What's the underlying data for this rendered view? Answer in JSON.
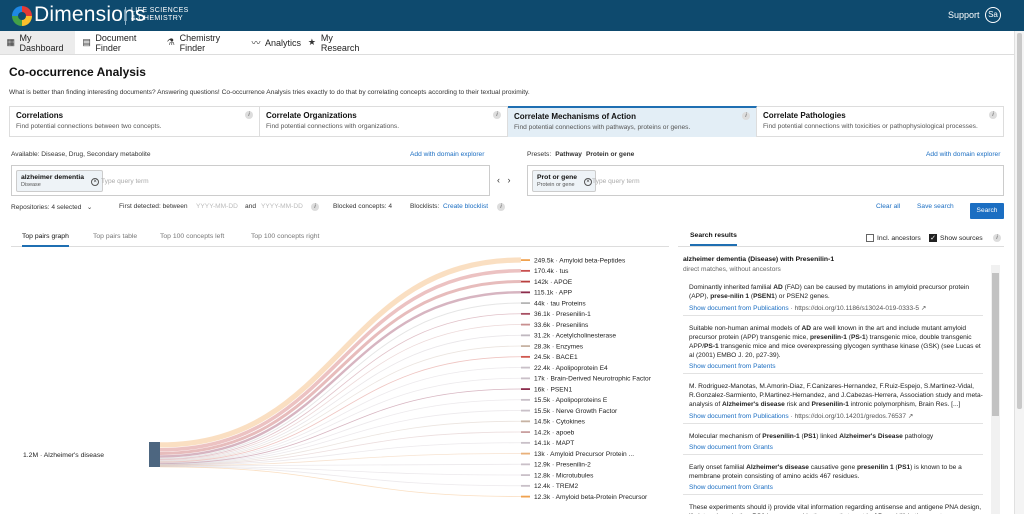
{
  "topbar": {
    "brand": "Dimensions",
    "brand_sub": "LIFE SCIENCES & CHEMISTRY",
    "support": "Support",
    "avatar": "Sa"
  },
  "nav": [
    {
      "label": "My Dashboard",
      "icon": "dashboard-icon",
      "glyph": "▦"
    },
    {
      "label": "Document Finder",
      "icon": "document-icon",
      "glyph": "▤"
    },
    {
      "label": "Chemistry Finder",
      "icon": "flask-icon",
      "glyph": "⚗"
    },
    {
      "label": "Analytics",
      "icon": "chart-line-icon",
      "glyph": "〰"
    },
    {
      "label": "My Research",
      "icon": "star-icon",
      "glyph": "★"
    }
  ],
  "page": {
    "title": "Co-occurrence Analysis",
    "description": "What is better than finding interesting documents? Answering questions! Co-occurrence Analysis tries exactly to do that by correlating concepts according to their textual proximity."
  },
  "cards": [
    {
      "title": "Correlations",
      "desc": "Find potential connections between two concepts."
    },
    {
      "title": "Correlate Organizations",
      "desc": "Find potential connections with organizations."
    },
    {
      "title": "Correlate Mechanisms of Action",
      "desc": "Find potential connections with pathways, proteins or genes."
    },
    {
      "title": "Correlate Pathologies",
      "desc": "Find potential connections with toxicities or pathophysiological processes."
    }
  ],
  "query": {
    "available": "Available: Disease, Drug, Secondary metabolite",
    "add_left": "Add with domain explorer",
    "presets_label": "Presets:",
    "preset1": "Pathway",
    "preset2": "Protein or gene",
    "add_right": "Add with domain explorer",
    "left_chip": {
      "term": "alzheimer dementia",
      "type": "Disease"
    },
    "left_placeholder": "Type query term",
    "right_chip": {
      "term": "Prot or gene",
      "type": "Protein or gene"
    },
    "right_placeholder": "Type query term"
  },
  "filters": {
    "repositories": "Repositories: 4 selected",
    "first_detected": "First detected: between",
    "date_ph1": "YYYY-MM-DD",
    "and": "and",
    "date_ph2": "YYYY-MM-DD",
    "blocked": "Blocked concepts: 4",
    "blocklists": "Blocklists:",
    "create_blocklist": "Create blocklist",
    "clear_all": "Clear all",
    "save_search": "Save search",
    "search": "Search"
  },
  "tabs": [
    "Top pairs graph",
    "Top pairs table",
    "Top 100 concepts left",
    "Top 100 concepts right"
  ],
  "chart_data": {
    "type": "sankey",
    "source": {
      "label": "1.2M · Alzheimer's disease",
      "value": 1200000
    },
    "targets": [
      {
        "label": "249.5k · Amyloid beta-Peptides",
        "value": 249500,
        "color": "#f0a24f"
      },
      {
        "label": "170.4k · tus",
        "value": 170400,
        "color": "#c94f4f"
      },
      {
        "label": "142k · APOE",
        "value": 142000,
        "color": "#b9403f"
      },
      {
        "label": "115.1k · APP",
        "value": 115100,
        "color": "#8c2c4c"
      },
      {
        "label": "44k · tau Proteins",
        "value": 44000,
        "color": "#b5b5b5"
      },
      {
        "label": "36.1k · Presenilin-1",
        "value": 36100,
        "color": "#a85063"
      },
      {
        "label": "33.6k · Presenilins",
        "value": 33600,
        "color": "#c99090"
      },
      {
        "label": "31.2k · Acetylcholinesterase",
        "value": 31200,
        "color": "#c0b8c0"
      },
      {
        "label": "28.3k · Enzymes",
        "value": 28300,
        "color": "#c7b3a3"
      },
      {
        "label": "24.5k · BACE1",
        "value": 24500,
        "color": "#d0584f"
      },
      {
        "label": "22.4k · Apolipoprotein E4",
        "value": 22400,
        "color": "#c9c0c8"
      },
      {
        "label": "17k · Brain-Derived Neurotrophic Factor",
        "value": 17000,
        "color": "#c9c0c8"
      },
      {
        "label": "16k · PSEN1",
        "value": 16000,
        "color": "#8c2c4c"
      },
      {
        "label": "15.5k · Apolipoproteins E",
        "value": 15500,
        "color": "#c9c0c8"
      },
      {
        "label": "15.5k · Nerve Growth Factor",
        "value": 15500,
        "color": "#c9c0c8"
      },
      {
        "label": "14.5k · Cytokines",
        "value": 14500,
        "color": "#c7b3a3"
      },
      {
        "label": "14.2k · apoeb",
        "value": 14200,
        "color": "#c9a0a0"
      },
      {
        "label": "14.1k · MAPT",
        "value": 14100,
        "color": "#c9c0c8"
      },
      {
        "label": "13k · Amyloid Precursor Protein ...",
        "value": 13000,
        "color": "#e9b07a"
      },
      {
        "label": "12.9k · Presenilin-2",
        "value": 12900,
        "color": "#c9c0c8"
      },
      {
        "label": "12.8k · Microtubules",
        "value": 12800,
        "color": "#c9c0c8"
      },
      {
        "label": "12.4k · TREM2",
        "value": 12400,
        "color": "#c9c0c8"
      },
      {
        "label": "12.3k · Amyloid beta-Protein Precursor",
        "value": 12300,
        "color": "#f0a24f"
      }
    ]
  },
  "results": {
    "tab": "Search results",
    "incl_ancestors": "Incl. ancestors",
    "incl_checked": false,
    "show_sources": "Show sources",
    "show_checked": true,
    "title": "alzheimer dementia (Disease) with Presenilin-1",
    "subtitle": "direct matches, without ancestors",
    "items": [
      {
        "html": "Dominantly inherited familial <b>AD</b> (FAD) can be caused by mutations in amyloid precursor protein (APP), <b>prese-nilin 1</b> (<b>PSEN1</b>) or PSEN2 genes.",
        "link": "Show document from Publications",
        "extra": " · https://doi.org/10.1186/s13024-019-0333-5 ↗"
      },
      {
        "html": "Suitable non-human animal models of <b>AD</b> are well known in the art and include mutant amyloid precursor protein (APP) transgenic mice, <b>presenilin-1</b> (<b>PS-1</b>) transgenic mice, double transgenic APP/<b>PS-1</b> transgenic mice and mice overexpressing glycogen synthase kinase (GSK) (see Lucas et al (2001) EMBO J. 20, p27-39).",
        "link": "Show document from Patents",
        "extra": ""
      },
      {
        "html": "M. Rodriguez-Manotas, M.Amorin-Diaz, F.Canizares-Hernandez, F.Ruiz-Espejo, S.Martinez-Vidal, R.Gonzalez-Sarmiento, P.Martinez-Hernandez, and J.Cabezas-Herrera, Association study and meta-analysis of <b>Alzheimer's disease</b> risk and <b>Presenilin-1</b> intronic polymorphism, Brain Res. [...]",
        "link": "Show document from Publications",
        "extra": " · https://doi.org/10.14201/gredos.76537 ↗"
      },
      {
        "html": "Molecular mechanism of <b>Presenilin-1</b> (<b>PS1</b>) linked <b>Alzheimer's Disease</b> pathology",
        "link": "Show document from Grants",
        "extra": ""
      },
      {
        "html": "Early onset familial <b>Alzheimer's disease</b> causative gene <b>presenilin 1</b> (<b>PS1</b>) is known to be a membrane protein consisting of amino acids 467 residues.",
        "link": "Show document from Grants",
        "extra": ""
      },
      {
        "html": "These experiments should i) provide vital information regarding antisense and antigene PNA design, ii) determine whether <b>PS1</b> is a reasonable therapeutic target in <b>AD</b>, and iii) in the event",
        "link": "",
        "extra": ""
      }
    ]
  }
}
